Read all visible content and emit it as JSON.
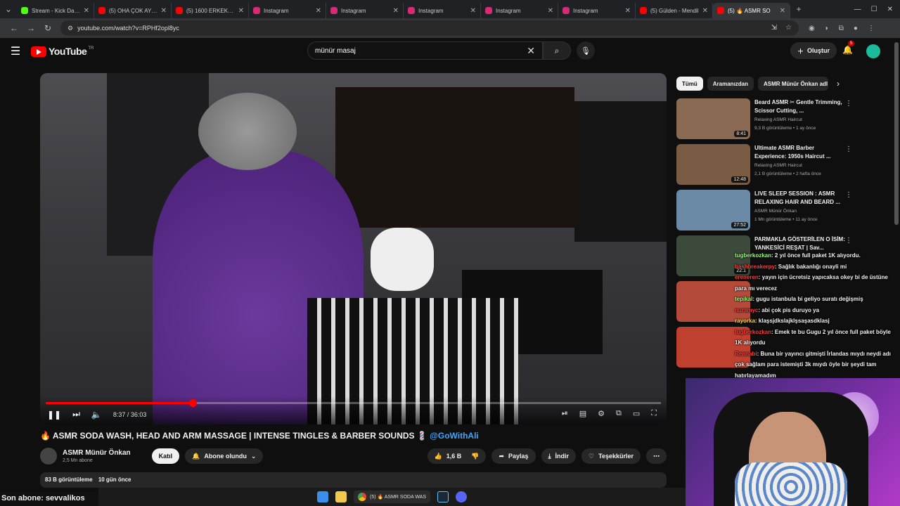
{
  "browser": {
    "tabs": [
      {
        "label": "Stream - Kick Dashb",
        "color": "#53fc18"
      },
      {
        "label": "(5) OHA ÇOK AYIP!",
        "color": "#ff0000"
      },
      {
        "label": "(5) 1600 ERKEKLE B",
        "color": "#ff0000"
      },
      {
        "label": "Instagram",
        "color": "#d62976"
      },
      {
        "label": "Instagram",
        "color": "#d62976"
      },
      {
        "label": "Instagram",
        "color": "#d62976"
      },
      {
        "label": "Instagram",
        "color": "#d62976"
      },
      {
        "label": "Instagram",
        "color": "#d62976"
      },
      {
        "label": "(5) Gülden - Mendil",
        "color": "#ff0000"
      },
      {
        "label": "(5) 🔥 ASMR SO",
        "color": "#ff0000"
      }
    ],
    "url": "youtube.com/watch?v=RPHf2opl8yc"
  },
  "youtube": {
    "logo_text": "YouTube",
    "region": "TR",
    "search_value": "münür masaj",
    "create_label": "Oluştur",
    "notifications": "5"
  },
  "player": {
    "time": "8:37 / 36:03",
    "progress": 0.239
  },
  "video": {
    "title": "🔥 ASMR SODA WASH, HEAD AND ARM MASSAGE | INTENSE TINGLES & BARBER SOUNDS 💈",
    "mention": "@GoWithAli",
    "channel": "ASMR Münür Önkan",
    "subscribers": "2,5 Mn abone",
    "join_label": "Katıl",
    "subscribed_label": "Abone olundu",
    "likes": "1,6 B",
    "share_label": "Paylaş",
    "download_label": "İndir",
    "thanks_label": "Teşekkürler",
    "views": "83 B görüntüleme",
    "date": "10 gün önce"
  },
  "chips": [
    "Tümü",
    "Aramanızdan",
    "ASMR Münür Önkan adl"
  ],
  "recommendations": [
    {
      "title": "Beard ASMR ✂ Gentle Trimming, Scissor Cutting, ...",
      "channel": "Relaxing ASMR Haircut",
      "meta": "9,3 B görüntüleme • 1 ay önce",
      "duration": "8:41",
      "thumb": "#8a6a52"
    },
    {
      "title": "Ultimate ASMR Barber Experience: 1950s Haircut ...",
      "channel": "Relaxing ASMR Haircut",
      "meta": "2,1 B görüntüleme • 2 hafta önce",
      "duration": "12:48",
      "thumb": "#7a5c44"
    },
    {
      "title": "LIVE SLEEP SESSION : ASMR RELAXING HAIR AND BEARD ...",
      "channel": "ASMR Münür Önkan",
      "meta": "1 Mn görüntüleme • 11 ay önce",
      "duration": "27:52",
      "thumb": "#6a8aa6"
    },
    {
      "title": "PARMAKLA GÖSTERİLEN O İSİM: YANKESİCİ REŞAT | Sav...",
      "channel": "",
      "meta": "",
      "duration": "22:1",
      "thumb": "#3b4a3a"
    },
    {
      "title": "",
      "channel": "",
      "meta": "",
      "duration": "",
      "thumb": "#b44a3a"
    },
    {
      "title": "",
      "channel": "",
      "meta": "",
      "duration": "",
      "thumb": "#c04030"
    }
  ],
  "chat": [
    {
      "user": "tugberkozkan",
      "msg": ": 2 yıl önce full paket 1K alıyordu."
    },
    {
      "user": "bashbreakerpy",
      "msg": ": Sağlık bakanlığı onayli mi"
    },
    {
      "user": "ereneren",
      "msg": ": yayın için ücretsiz yapıcaksa okey bi de üstüne para mı verecez"
    },
    {
      "user": "tepikal",
      "msg": ": gugu istanbula bi geliyo suratı değişmiş"
    },
    {
      "user": "nuramyc",
      "msg": ": abi çok pis duruyo ya"
    },
    {
      "user": "rayorka",
      "msg": ": klaşsjdkslajklşsaşasdklasj"
    },
    {
      "user": "tugberkozkan",
      "msg": ": Emek te bu Gugu 2 yıl önce full paket böyle 1K alıyordu"
    },
    {
      "user": "Rennabi",
      "msg": ": Buna bir yayıncı gitmişti İrlandas mıydı neydi adı çok sağlam para istemişti 3k mıydı öyle bir şeydi tam hatırlayamadım"
    }
  ],
  "overlay": {
    "last_sub": "Son abone: sevvalikos"
  },
  "taskbar": {
    "app_label": "(5) 🔥 ASMR SODA WAS"
  }
}
